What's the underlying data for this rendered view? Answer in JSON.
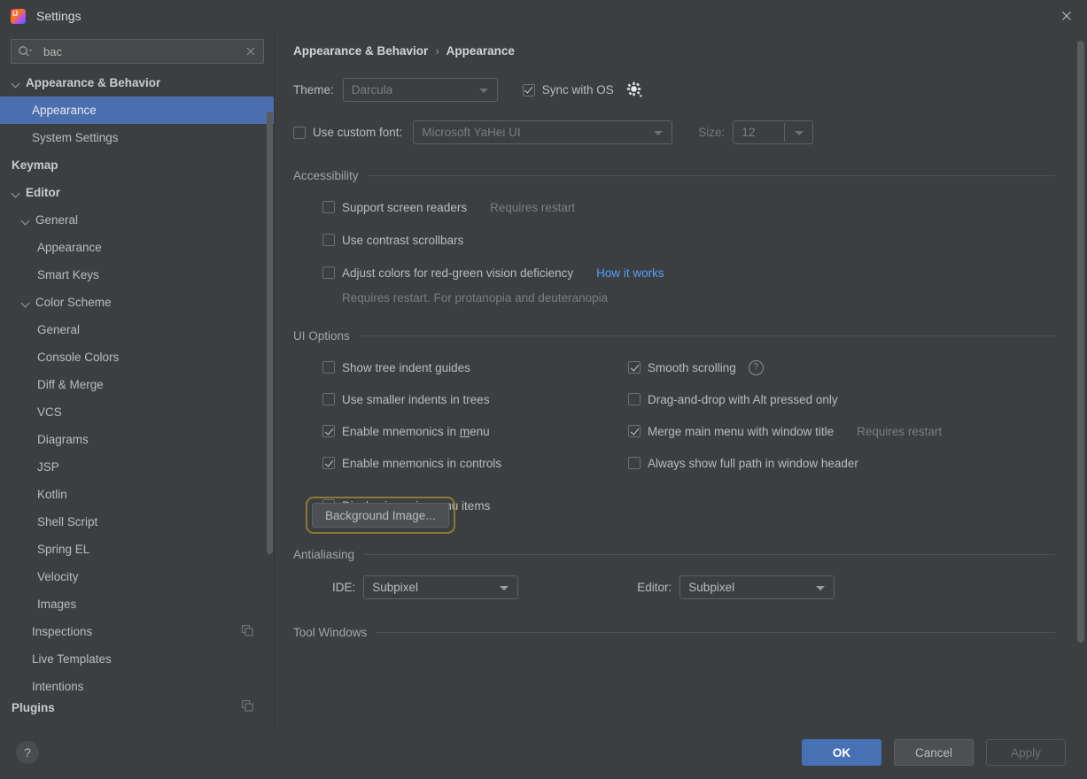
{
  "window": {
    "title": "Settings",
    "logo_icon": "intellij-idea-logo",
    "close_icon": "close-icon"
  },
  "search": {
    "value": "bac",
    "placeholder": "",
    "icon": "search-icon",
    "clear_icon": "clear-icon"
  },
  "sidebar": {
    "items": [
      {
        "label": "Appearance & Behavior",
        "level": 0,
        "bold": true,
        "twisty": "expanded",
        "selected": false,
        "badge": null
      },
      {
        "label": "Appearance",
        "level": 1,
        "bold": false,
        "twisty": "none",
        "selected": true,
        "badge": null
      },
      {
        "label": "System Settings",
        "level": 1,
        "bold": false,
        "twisty": "none",
        "selected": false,
        "badge": null
      },
      {
        "label": "Keymap",
        "level": 0,
        "bold": true,
        "twisty": "none",
        "selected": false,
        "badge": null
      },
      {
        "label": "Editor",
        "level": 0,
        "bold": true,
        "twisty": "expanded",
        "selected": false,
        "badge": null
      },
      {
        "label": "General",
        "level": 1,
        "bold": false,
        "twisty": "expanded",
        "selected": false,
        "badge": null
      },
      {
        "label": "Appearance",
        "level": 2,
        "bold": false,
        "twisty": "none",
        "selected": false,
        "badge": null
      },
      {
        "label": "Smart Keys",
        "level": 2,
        "bold": false,
        "twisty": "none",
        "selected": false,
        "badge": null
      },
      {
        "label": "Color Scheme",
        "level": 1,
        "bold": false,
        "twisty": "expanded",
        "selected": false,
        "badge": null
      },
      {
        "label": "General",
        "level": 2,
        "bold": false,
        "twisty": "none",
        "selected": false,
        "badge": null
      },
      {
        "label": "Console Colors",
        "level": 2,
        "bold": false,
        "twisty": "none",
        "selected": false,
        "badge": null
      },
      {
        "label": "Diff & Merge",
        "level": 2,
        "bold": false,
        "twisty": "none",
        "selected": false,
        "badge": null
      },
      {
        "label": "VCS",
        "level": 2,
        "bold": false,
        "twisty": "none",
        "selected": false,
        "badge": null
      },
      {
        "label": "Diagrams",
        "level": 2,
        "bold": false,
        "twisty": "none",
        "selected": false,
        "badge": null
      },
      {
        "label": "JSP",
        "level": 2,
        "bold": false,
        "twisty": "none",
        "selected": false,
        "badge": null
      },
      {
        "label": "Kotlin",
        "level": 2,
        "bold": false,
        "twisty": "none",
        "selected": false,
        "badge": null
      },
      {
        "label": "Shell Script",
        "level": 2,
        "bold": false,
        "twisty": "none",
        "selected": false,
        "badge": null
      },
      {
        "label": "Spring EL",
        "level": 2,
        "bold": false,
        "twisty": "none",
        "selected": false,
        "badge": null
      },
      {
        "label": "Velocity",
        "level": 2,
        "bold": false,
        "twisty": "none",
        "selected": false,
        "badge": null
      },
      {
        "label": "Images",
        "level": 2,
        "bold": false,
        "twisty": "none",
        "selected": false,
        "badge": null
      },
      {
        "label": "Inspections",
        "level": 1,
        "bold": false,
        "twisty": "none",
        "selected": false,
        "badge": "project-scope-icon"
      },
      {
        "label": "Live Templates",
        "level": 1,
        "bold": false,
        "twisty": "none",
        "selected": false,
        "badge": null
      },
      {
        "label": "Intentions",
        "level": 1,
        "bold": false,
        "twisty": "none",
        "selected": false,
        "badge": null
      },
      {
        "label": "Plugins",
        "level": 0,
        "bold": true,
        "twisty": "none",
        "selected": false,
        "badge": "project-scope-icon"
      }
    ]
  },
  "content": {
    "breadcrumb": {
      "parent": "Appearance & Behavior",
      "separator": "›",
      "current": "Appearance"
    },
    "theme": {
      "label": "Theme:",
      "value": "Darcula",
      "sync_with_os_label": "Sync with OS",
      "sync_with_os_checked": true,
      "gear_icon": "gear-icon"
    },
    "custom_font": {
      "label": "Use custom font:",
      "checked": false,
      "font_value": "Microsoft YaHei UI",
      "size_label": "Size:",
      "size_value": "12"
    },
    "accessibility": {
      "title": "Accessibility",
      "items": [
        {
          "label": "Support screen readers",
          "checked": false,
          "note": "Requires restart",
          "link": null
        },
        {
          "label": "Use contrast scrollbars",
          "checked": false,
          "note": null,
          "link": null
        },
        {
          "label": "Adjust colors for red-green vision deficiency",
          "checked": false,
          "note": null,
          "link": "How it works"
        }
      ],
      "subnote": "Requires restart. For protanopia and deuteranopia"
    },
    "ui_options": {
      "title": "UI Options",
      "left": [
        {
          "label": "Show tree indent guides",
          "checked": false,
          "mnemonic": null,
          "help": false
        },
        {
          "label": "Use smaller indents in trees",
          "checked": false,
          "mnemonic": null,
          "help": false
        },
        {
          "label": "Enable mnemonics in menu",
          "checked": true,
          "mnemonic": "m",
          "help": false
        },
        {
          "label": "Enable mnemonics in controls",
          "checked": true,
          "mnemonic": null,
          "help": false
        },
        {
          "label": "Display icons in menu items",
          "checked": true,
          "mnemonic": null,
          "help": false
        }
      ],
      "right": [
        {
          "label": "Smooth scrolling",
          "checked": true,
          "note": null,
          "help": true
        },
        {
          "label": "Drag-and-drop with Alt pressed only",
          "checked": false,
          "note": null,
          "help": false
        },
        {
          "label": "Merge main menu with window title",
          "checked": true,
          "note": "Requires restart",
          "help": false
        },
        {
          "label": "Always show full path in window header",
          "checked": false,
          "note": null,
          "help": false
        }
      ],
      "background_image_button": "Background Image...",
      "background_image_highlighted": true
    },
    "antialiasing": {
      "title": "Antialiasing",
      "ide_label": "IDE:",
      "ide_value": "Subpixel",
      "editor_label": "Editor:",
      "editor_value": "Subpixel"
    },
    "tool_windows": {
      "title": "Tool Windows"
    }
  },
  "footer": {
    "help_label": "?",
    "ok": "OK",
    "cancel": "Cancel",
    "apply": "Apply",
    "apply_enabled": false
  },
  "colors": {
    "background": "#3c3f41",
    "selection": "#4b6eaf",
    "accent_button": "#4671b5",
    "link": "#589df6",
    "highlight_ring": "#8a7a33",
    "text": "#bbbbbb",
    "text_dim": "#7b7e80"
  }
}
